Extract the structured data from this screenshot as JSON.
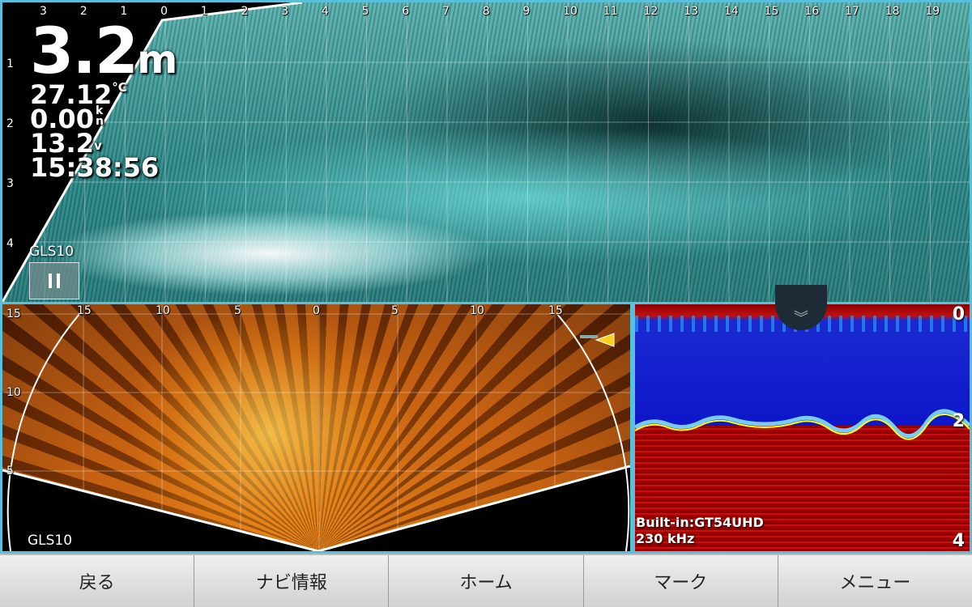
{
  "top_view": {
    "x_ticks": [
      "3",
      "2",
      "1",
      "0",
      "1",
      "2",
      "3",
      "4",
      "5",
      "6",
      "7",
      "8",
      "9",
      "10",
      "11",
      "12",
      "13",
      "14",
      "15",
      "16",
      "17",
      "18",
      "19"
    ],
    "y_ticks": [
      "1",
      "2",
      "3",
      "4"
    ],
    "depth": "3.2",
    "depth_unit": "m",
    "water_temp": "27.12",
    "water_temp_unit": "°C",
    "speed": "0.00",
    "speed_unit_top": "k",
    "speed_unit_bottom": "n",
    "voltage": "13.2",
    "voltage_unit": "v",
    "time": "15:38:56",
    "source": "GLS10"
  },
  "bottom_left_view": {
    "x_ticks": [
      "15",
      "10",
      "5",
      "0",
      "5",
      "10",
      "15"
    ],
    "y_ticks": [
      "15",
      "10",
      "5"
    ],
    "source": "GLS10"
  },
  "bottom_right_view": {
    "depth_scale": [
      "0",
      "2",
      "4"
    ],
    "source_line1": "Built-in:GT54UHD",
    "source_line2": "230 kHz"
  },
  "toolbar": {
    "back": "戻る",
    "navi_info": "ナビ情報",
    "home": "ホーム",
    "mark": "マーク",
    "menu": "メニュー"
  },
  "colors": {
    "frame": "#58c0dc",
    "top_sonar": "#3f9a98",
    "bottom_left_sonar": "#e07612",
    "bottom_right_water": "#0a12c8"
  }
}
